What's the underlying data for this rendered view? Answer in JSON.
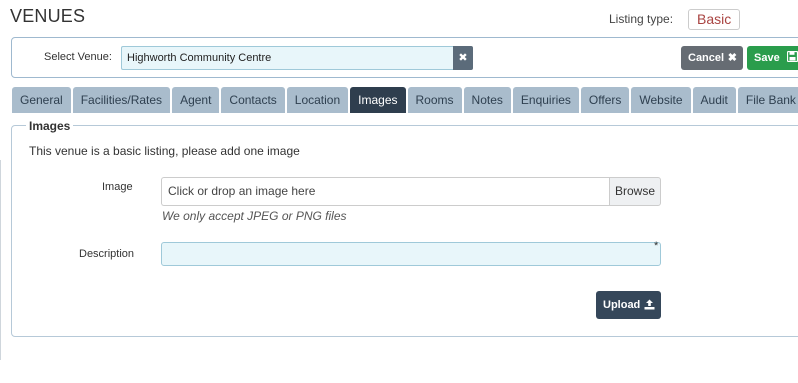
{
  "header": {
    "title": "VENUES",
    "listing_type_label": "Listing type:",
    "listing_type_value": "Basic"
  },
  "venue_bar": {
    "select_label": "Select Venue:",
    "selected_venue": "Highworth Community Centre",
    "clear_icon": "✖",
    "cancel_label": "Cancel",
    "cancel_icon": "✖",
    "save_label": "Save",
    "save_icon": "floppy-disk-icon"
  },
  "tabs": [
    {
      "label": "General",
      "active": false
    },
    {
      "label": "Facilities/Rates",
      "active": false
    },
    {
      "label": "Agent",
      "active": false
    },
    {
      "label": "Contacts",
      "active": false
    },
    {
      "label": "Location",
      "active": false
    },
    {
      "label": "Images",
      "active": true
    },
    {
      "label": "Rooms",
      "active": false
    },
    {
      "label": "Notes",
      "active": false
    },
    {
      "label": "Enquiries",
      "active": false
    },
    {
      "label": "Offers",
      "active": false
    },
    {
      "label": "Website",
      "active": false
    },
    {
      "label": "Audit",
      "active": false
    },
    {
      "label": "File Bank",
      "active": false
    }
  ],
  "images_panel": {
    "legend": "Images",
    "note": "This venue is a basic listing, please add one image",
    "image_label": "Image",
    "file_placeholder": "Click or drop an image here",
    "browse_label": "Browse",
    "file_hint": "We only accept JPEG or PNG files",
    "description_label": "Description",
    "description_value": "",
    "required_marker": "*",
    "upload_label": "Upload",
    "upload_icon": "upload-icon"
  },
  "colors": {
    "active_tab": "#2f3e4e",
    "inactive_tab": "#a9bccc",
    "save_green": "#2a9d4c",
    "cancel_grey": "#666c73",
    "upload_navy": "#35475a",
    "input_bg": "#e8f6fa",
    "basic_badge_text": "#a94442"
  }
}
